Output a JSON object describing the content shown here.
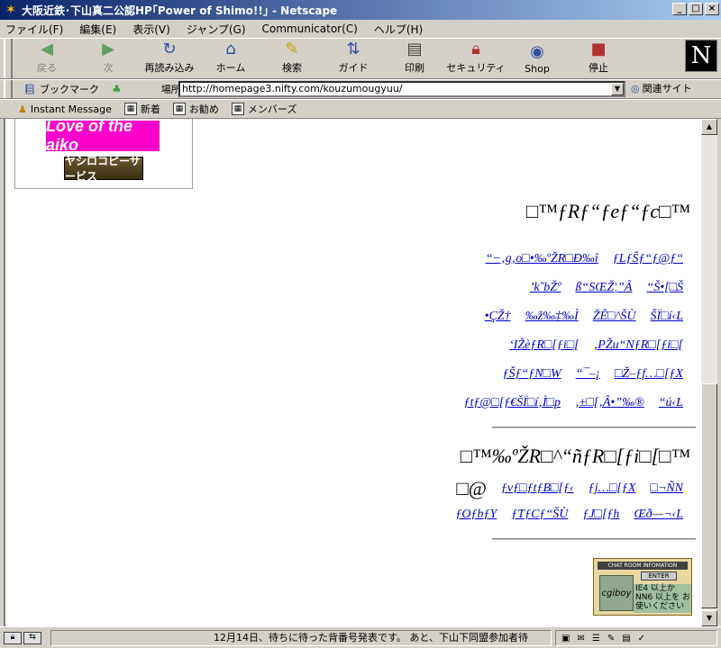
{
  "window": {
    "title": "大阪近鉄･下山真二公認HP｢Power of Shimo!!｣ - Netscape"
  },
  "menu": [
    "ファイル(F)",
    "編集(E)",
    "表示(V)",
    "ジャンプ(G)",
    "Communicator(C)",
    "ヘルプ(H)"
  ],
  "toolbar": {
    "buttons": [
      {
        "label": "戻る",
        "icon": "back-arrow-icon",
        "enabled": false
      },
      {
        "label": "次",
        "icon": "forward-arrow-icon",
        "enabled": false
      },
      {
        "label": "再読み込み",
        "icon": "reload-icon",
        "enabled": true
      },
      {
        "label": "ホーム",
        "icon": "home-icon",
        "enabled": true
      },
      {
        "label": "検索",
        "icon": "search-icon",
        "enabled": true
      },
      {
        "label": "ガイド",
        "icon": "guide-icon",
        "enabled": true
      },
      {
        "label": "印刷",
        "icon": "print-icon",
        "enabled": true
      },
      {
        "label": "セキュリティ",
        "icon": "lock-icon",
        "enabled": true
      },
      {
        "label": "Shop",
        "icon": "shop-icon",
        "enabled": true
      },
      {
        "label": "停止",
        "icon": "stop-icon",
        "enabled": true
      }
    ]
  },
  "location": {
    "bookmarks_label": "ブックマーク",
    "location_label": "場所:",
    "url": "http://homepage3.nifty.com/kouzumougyuu/",
    "related_label": "関連サイト"
  },
  "personal_toolbar": [
    "Instant Message",
    "新着",
    "お勧め",
    "メンバーズ"
  ],
  "content": {
    "banner1": "Love of the aiko",
    "banner2": "ヤシロコピーサービス",
    "section1_heading": "□™ƒRƒ“ƒeƒ“ƒc□™",
    "section1_rows": [
      [
        "“−‚g‚o□•‰ºŽR□Ð‰î",
        "ƒLƒŠƒ“ƒ@ƒ“"
      ],
      [
        "’k˜bŽº",
        "ß“SŒŽ¦”Â",
        "“Š•[□Š"
      ],
      [
        "•ÇŽ†",
        "‰ž‰‡‰Ì",
        "ŽÊ□^ŠÙ",
        "ŠÏ□í‹L"
      ],
      [
        "‘IŽèƒR□[ƒi□[",
        "‚PŽu“NƒR□[ƒi□["
      ],
      [
        "ƒŠƒ“ƒN□W",
        "“¯–¡",
        "□Ž–ƒf…□[ƒX"
      ],
      [
        "ƒtƒ@□[ƒ€ŠÏ□í‚Ì□p",
        "‚±□[‚Â•”‰®",
        "“ú‹L"
      ]
    ],
    "section2_heading": "□™‰ºŽR□^“ñƒR□[ƒi□[□™",
    "section2_lead": "□@",
    "section2_rows": [
      [
        "ƒvƒ□ƒtƒB□[ƒ‹",
        "ƒj…□[ƒX",
        "□¬ÑN"
      ],
      [
        "ƒOƒbƒY",
        "ƒTƒCƒ“ŠÙ",
        "ƒJ□[ƒh",
        "Œð—¬‹L"
      ]
    ],
    "chat_banner": {
      "title": "CHAT ROOM INFOMATION",
      "enter": "ENTER",
      "logo": "cgiboy",
      "note": "IE4 以上か NN6 以上を お使いください"
    }
  },
  "status": {
    "message": "12月14日、待ちに待った背番号発表です。 あと、下山下同盟参加者待"
  },
  "colors": {
    "titlebar": "#0a246a",
    "link": "#0000cc",
    "banner1_bg": "#ff00cc"
  }
}
